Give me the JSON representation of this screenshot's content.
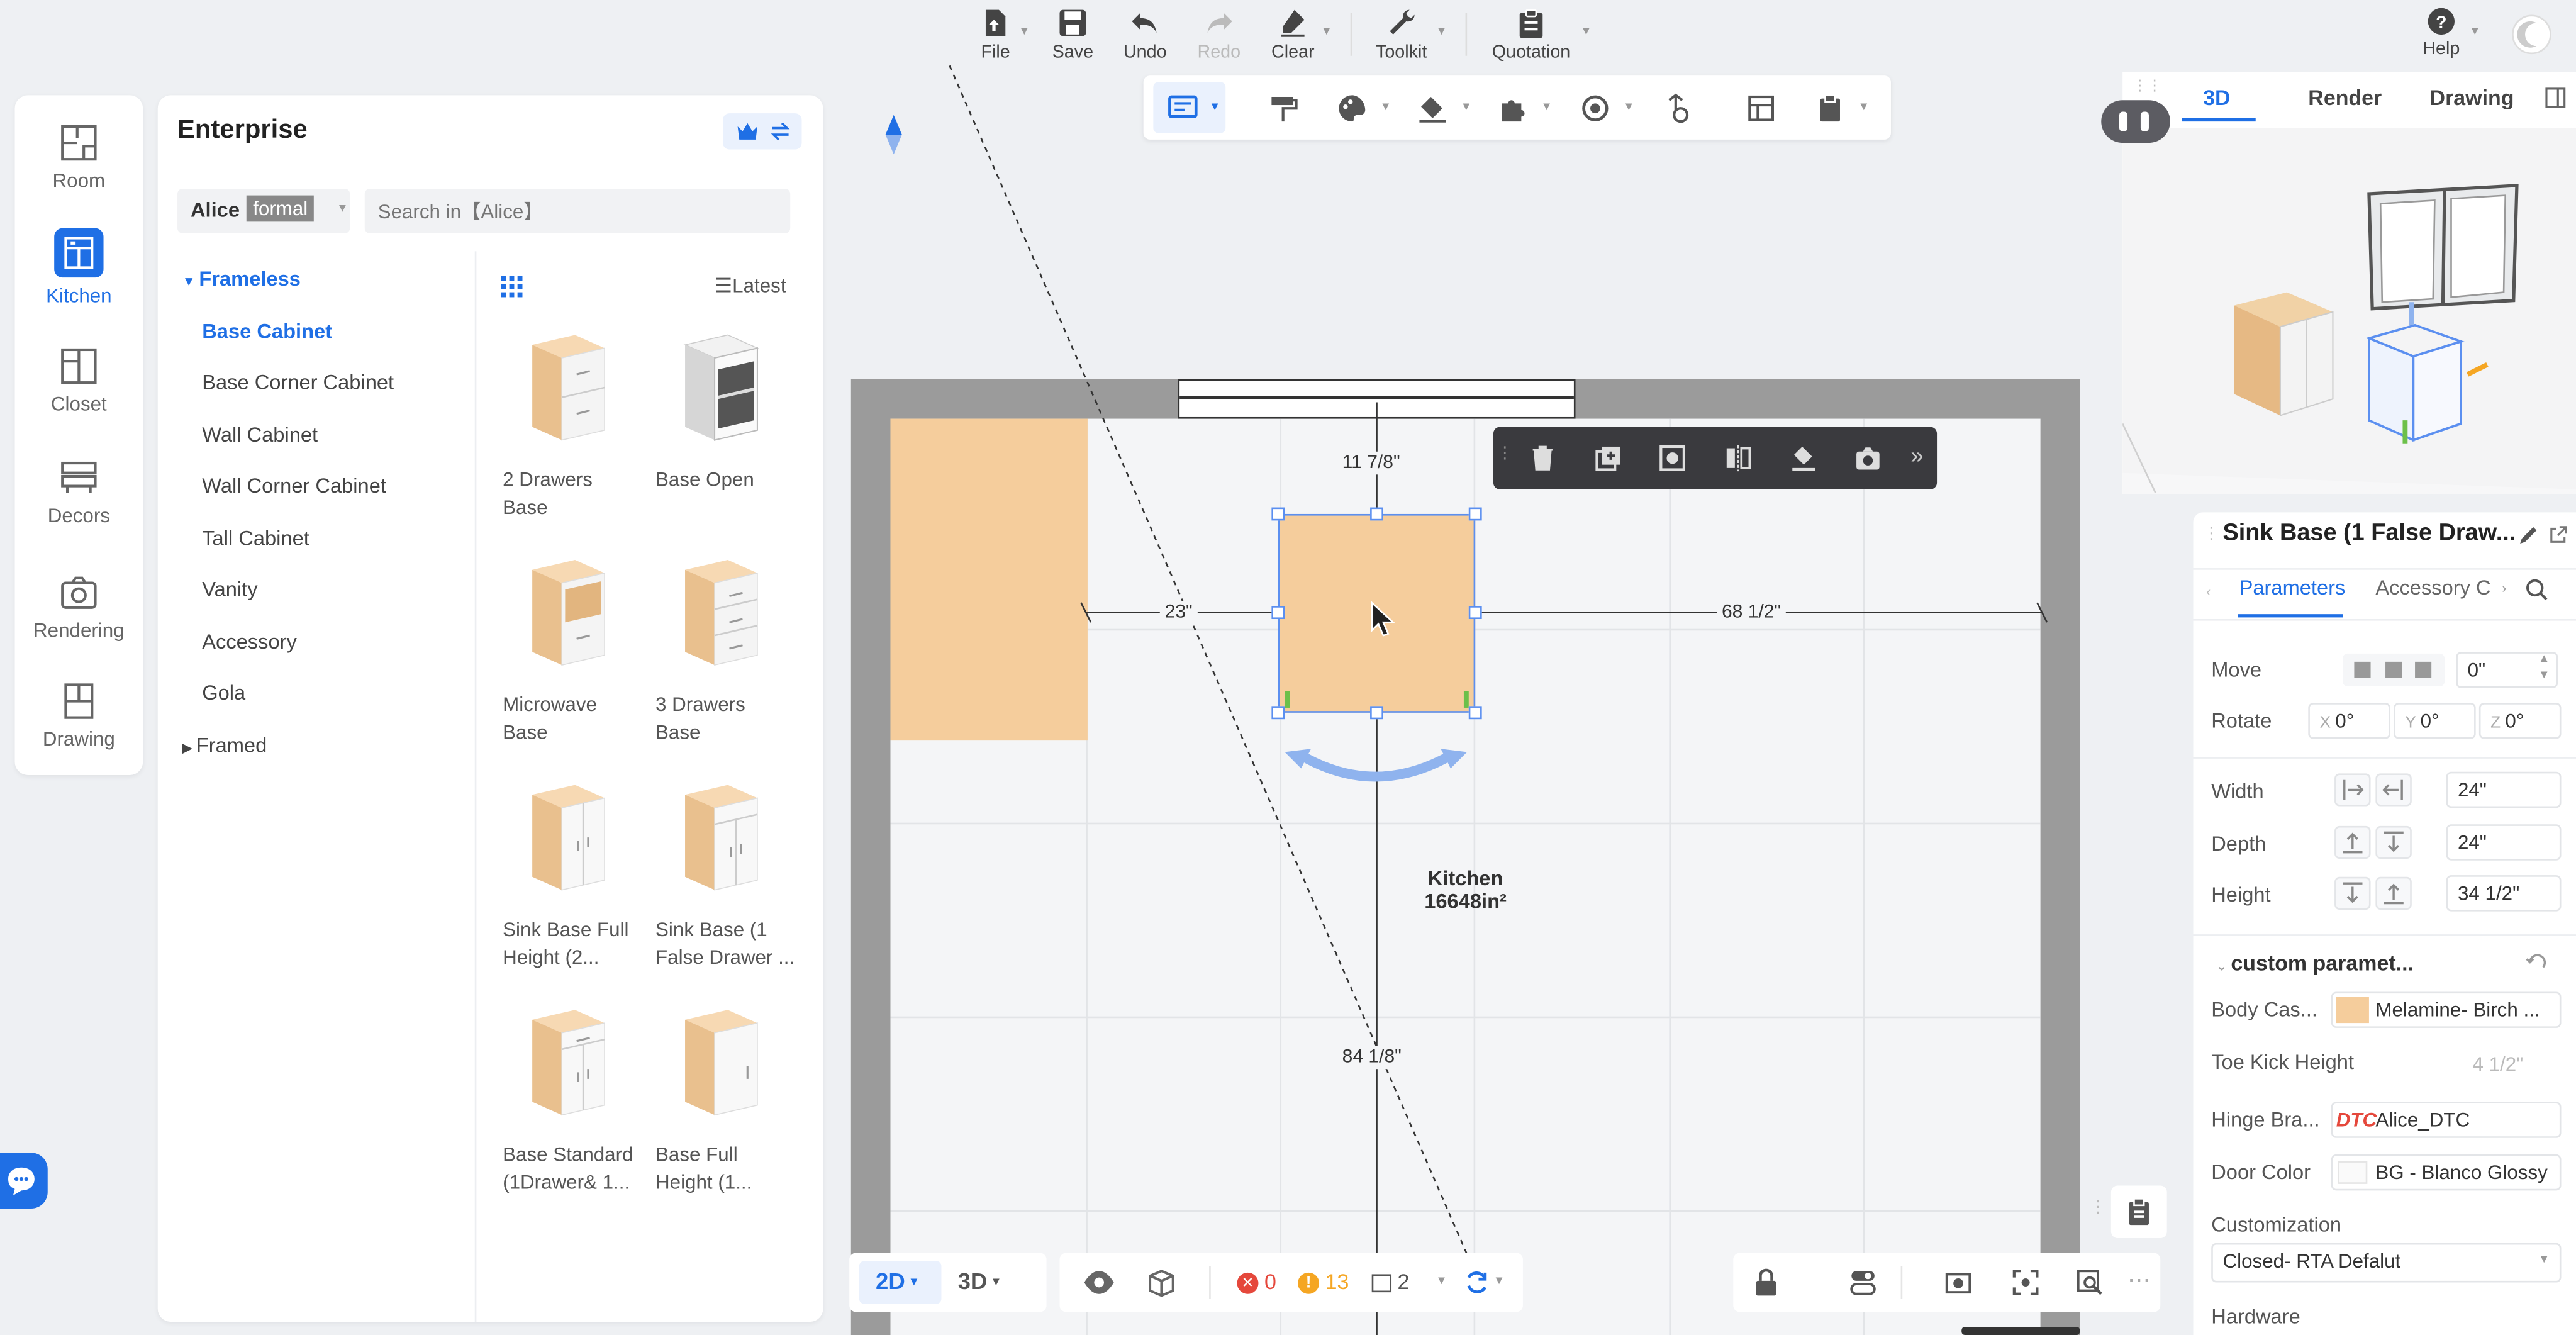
{
  "toolbar": {
    "file": "File",
    "save": "Save",
    "undo": "Undo",
    "redo": "Redo",
    "clear": "Clear",
    "toolkit": "Toolkit",
    "quotation": "Quotation",
    "help": "Help"
  },
  "left_nav": [
    "Room",
    "Kitchen",
    "Closet",
    "Decors",
    "Rendering",
    "Drawing"
  ],
  "library": {
    "title": "Enterprise",
    "brand": "Alice",
    "brand_badge": "formal",
    "search_placeholder": "Search in【Alice】",
    "group_open": "Frameless",
    "categories": [
      "Base Cabinet",
      "Base Corner Cabinet",
      "Wall Cabinet",
      "Wall Corner Cabinet",
      "Tall Cabinet",
      "Vanity",
      "Accessory",
      "Gola"
    ],
    "group_closed": "Framed",
    "sort": "Latest",
    "products": [
      {
        "line1": "2 Drawers",
        "line2": "Base"
      },
      {
        "line1": "Base Open",
        "line2": ""
      },
      {
        "line1": "Microwave",
        "line2": "Base"
      },
      {
        "line1": "3 Drawers",
        "line2": "Base"
      },
      {
        "line1": "Sink Base Full",
        "line2": "Height (2..."
      },
      {
        "line1": "Sink Base (1",
        "line2": "False Drawer ..."
      },
      {
        "line1": "Base Standard",
        "line2": "(1Drawer& 1..."
      },
      {
        "line1": "Base Full",
        "line2": "Height (1..."
      }
    ]
  },
  "canvas": {
    "dim_top": "11 7/8\"",
    "dim_left": "23\"",
    "dim_right": "68 1/2\"",
    "dim_bottom": "84 1/8\"",
    "room_name": "Kitchen",
    "room_area": "16648in²"
  },
  "bottom_bar": {
    "view_2d": "2D",
    "view_3d": "3D",
    "errors": "0",
    "warnings": "13",
    "layers": "2"
  },
  "view_tabs": [
    "3D",
    "Render",
    "Drawing"
  ],
  "properties": {
    "title": "Sink Base (1 False Draw...",
    "tab_parameters": "Parameters",
    "tab_accessory": "Accessory C",
    "move_label": "Move",
    "move_value": "0\"",
    "rotate_label": "Rotate",
    "rotate_x": "0°",
    "rotate_y": "0°",
    "rotate_z": "0°",
    "width_label": "Width",
    "width_value": "24\"",
    "depth_label": "Depth",
    "depth_value": "24\"",
    "height_label": "Height",
    "height_value": "34 1/2\"",
    "custom_section": "custom paramet...",
    "body_case_label": "Body Cas...",
    "body_case_value": "Melamine- Birch ...",
    "toe_kick_label": "Toe Kick Height",
    "toe_kick_value": "4 1/2\"",
    "hinge_label": "Hinge Bra...",
    "hinge_badge": "DTC",
    "hinge_value": "Alice_DTC",
    "door_color_label": "Door Color",
    "door_color_value": "BG - Blanco Glossy",
    "customization_label": "Customization",
    "customization_value": "Closed- RTA Defalut",
    "hardware_label": "Hardware"
  },
  "colors": {
    "accent": "#1f6fe5",
    "cabinet": "#f5cd9c",
    "wall": "#9b9b9b",
    "selection": "#5b8ff0"
  }
}
